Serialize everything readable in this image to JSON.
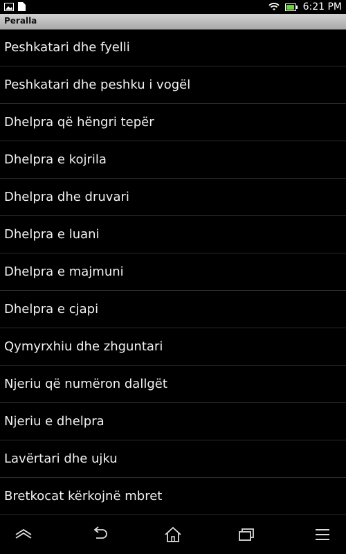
{
  "status_bar": {
    "time": "6:21 PM"
  },
  "title_bar": {
    "title": "Peralla"
  },
  "stories": [
    "Peshkatari dhe fyelli",
    "Peshkatari dhe peshku i vogël",
    "Dhelpra që hëngri tepër",
    "Dhelpra e kojrila",
    "Dhelpra dhe druvari",
    "Dhelpra e luani",
    "Dhelpra e majmuni",
    "Dhelpra e cjapi",
    "Qymyrxhiu dhe zhguntari",
    "Njeriu që numëron dallgët",
    "Njeriu e dhelpra",
    "Lavërtari dhe ujku",
    "Bretkocat kërkojnë mbret"
  ],
  "nav_bar": {
    "icons": [
      "home-up-icon",
      "back-icon",
      "home-icon",
      "recents-icon",
      "menu-icon"
    ]
  }
}
